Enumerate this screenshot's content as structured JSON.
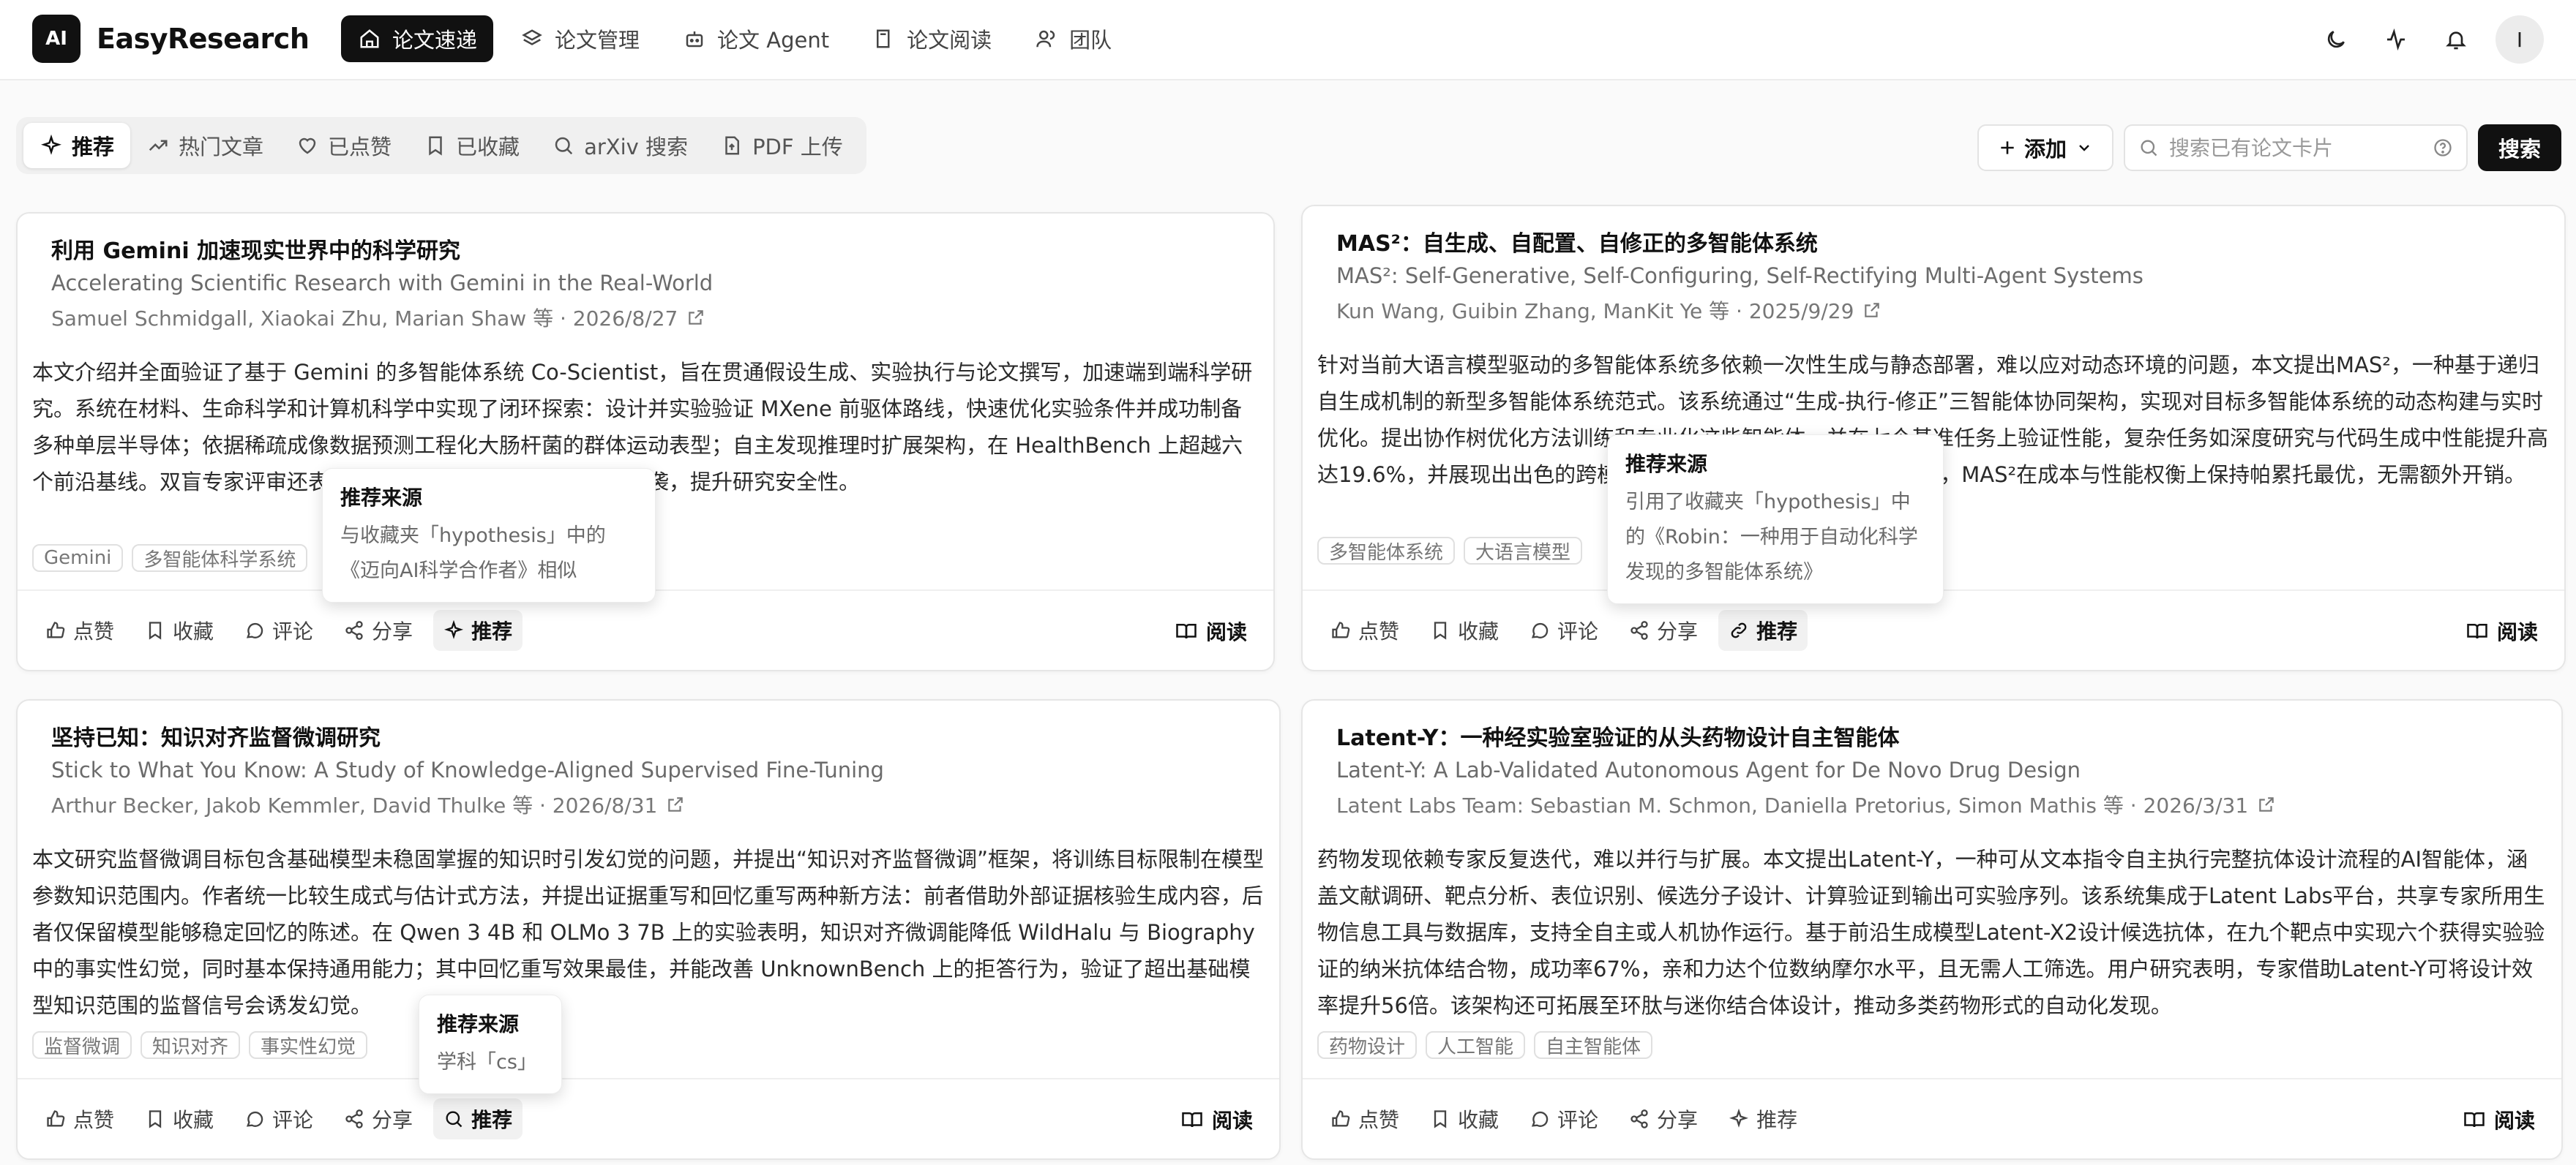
{
  "app": {
    "logo_mark": "AI",
    "name": "EasyResearch"
  },
  "nav": [
    {
      "label": "论文速递",
      "icon": "home-icon",
      "active": true
    },
    {
      "label": "论文管理",
      "icon": "layers-icon"
    },
    {
      "label": "论文 Agent",
      "icon": "bot-icon"
    },
    {
      "label": "论文阅读",
      "icon": "book-icon"
    },
    {
      "label": "团队",
      "icon": "users-icon"
    }
  ],
  "user": {
    "avatar_initial": "I"
  },
  "tabs": [
    {
      "label": "推荐",
      "icon": "sparkle-icon",
      "active": true
    },
    {
      "label": "热门文章",
      "icon": "trending-icon"
    },
    {
      "label": "已点赞",
      "icon": "heart-icon"
    },
    {
      "label": "已收藏",
      "icon": "bookmark-icon"
    },
    {
      "label": "arXiv 搜索",
      "icon": "search-icon"
    },
    {
      "label": "PDF 上传",
      "icon": "file-upload-icon"
    }
  ],
  "toolbar": {
    "add_label": "添加",
    "search_placeholder": "搜索已有论文卡片",
    "search_button": "搜索"
  },
  "actions": {
    "like": "点赞",
    "collect": "收藏",
    "comment": "评论",
    "share": "分享",
    "recommend": "推荐",
    "read": "阅读"
  },
  "cards": [
    {
      "title": "利用 Gemini 加速现实世界中的科学研究",
      "subtitle": "Accelerating Scientific Research with Gemini in the Real-World",
      "authors": "Samuel Schmidgall, Xiaokai Zhu, Marian Shaw 等 · 2026/8/27",
      "summary": "本文介绍并全面验证了基于 Gemini 的多智能体系统 Co-Scientist，旨在贯通假设生成、实验执行与论文撰写，加速端到端科学研究。系统在材料、生命科学和计算机科学中实现了闭环探索：设计并实验验证 MXene 前驱体路线，快速优化实验条件并成功制备多种单层半导体；依据稀疏成像数据预测工程化大肠杆菌的群体运动表型；自主发现推理时扩展架构，在 HealthBench 上超越六个前沿基线。双盲专家评审还表明，其可靠性模块可减少幻觉和抄袭，提升研究安全性。",
      "tags": [
        "Gemini",
        "多智能体科学系统"
      ],
      "tooltip": {
        "title": "推荐来源",
        "text": "与收藏夹「hypothesis」中的《迈向AI科学合作者》相似"
      }
    },
    {
      "title": "MAS²：自生成、自配置、自修正的多智能体系统",
      "subtitle": "MAS²: Self-Generative, Self-Configuring, Self-Rectifying Multi-Agent Systems",
      "authors": "Kun Wang, Guibin Zhang, ManKit Ye 等 · 2025/9/29",
      "summary": "针对当前大语言模型驱动的多智能体系统多依赖一次性生成与静态部署，难以应对动态环境的问题，本文提出MAS²，一种基于递归自生成机制的新型多智能体系统范式。该系统通过“生成-执行-修正”三智能体协同架构，实现对目标多智能体系统的动态构建与实时优化。提出协作树优化方法训练和专业化这些智能体，并在七个基准任务上验证性能，复杂任务如深度研究与代码生成中性能提升高达19.6%，并展现出出色的跨模型泛化能力，提升达15.1%。同时，MAS²在成本与性能权衡上保持帕累托最优，无需额外开销。",
      "tags": [
        "多智能体系统",
        "大语言模型"
      ],
      "tooltip": {
        "title": "推荐来源",
        "text": "引用了收藏夹「hypothesis」中的《Robin：一种用于自动化科学发现的多智能体系统》"
      }
    },
    {
      "title": "坚持已知：知识对齐监督微调研究",
      "subtitle": "Stick to What You Know: A Study of Knowledge-Aligned Supervised Fine-Tuning",
      "authors": "Arthur Becker, Jakob Kemmler, David Thulke 等 · 2026/8/31",
      "summary": "本文研究监督微调目标包含基础模型未稳固掌握的知识时引发幻觉的问题，并提出“知识对齐监督微调”框架，将训练目标限制在模型参数知识范围内。作者统一比较生成式与估计式方法，并提出证据重写和回忆重写两种新方法：前者借助外部证据核验生成内容，后者仅保留模型能够稳定回忆的陈述。在 Qwen 3 4B 和 OLMo 3 7B 上的实验表明，知识对齐微调能降低 WildHalu 与 Biography 中的事实性幻觉，同时基本保持通用能力；其中回忆重写效果最佳，并能改善 UnknownBench 上的拒答行为，验证了超出基础模型知识范围的监督信号会诱发幻觉。",
      "tags": [
        "监督微调",
        "知识对齐",
        "事实性幻觉"
      ],
      "tooltip": {
        "title": "推荐来源",
        "text": "学科「cs」"
      }
    },
    {
      "title": "Latent-Y：一种经实验室验证的从头药物设计自主智能体",
      "subtitle": "Latent-Y: A Lab-Validated Autonomous Agent for De Novo Drug Design",
      "authors": "Latent Labs Team: Sebastian M. Schmon, Daniella Pretorius, Simon Mathis 等 · 2026/3/31",
      "summary": "药物发现依赖专家反复迭代，难以并行与扩展。本文提出Latent-Y，一种可从文本指令自主执行完整抗体设计流程的AI智能体，涵盖文献调研、靶点分析、表位识别、候选分子设计、计算验证到输出可实验序列。该系统集成于Latent Labs平台，共享专家所用生物信息工具与数据库，支持全自主或人机协作运行。基于前沿生成模型Latent-X2设计候选抗体，在九个靶点中实现六个获得实验验证的纳米抗体结合物，成功率67%，亲和力达个位数纳摩尔水平，且无需人工筛选。用户研究表明，专家借助Latent-Y可将设计效率提升56倍。该架构还可拓展至环肽与迷你结合体设计，推动多类药物形式的自动化发现。",
      "tags": [
        "药物设计",
        "人工智能",
        "自主智能体"
      ],
      "tooltip": null
    }
  ]
}
